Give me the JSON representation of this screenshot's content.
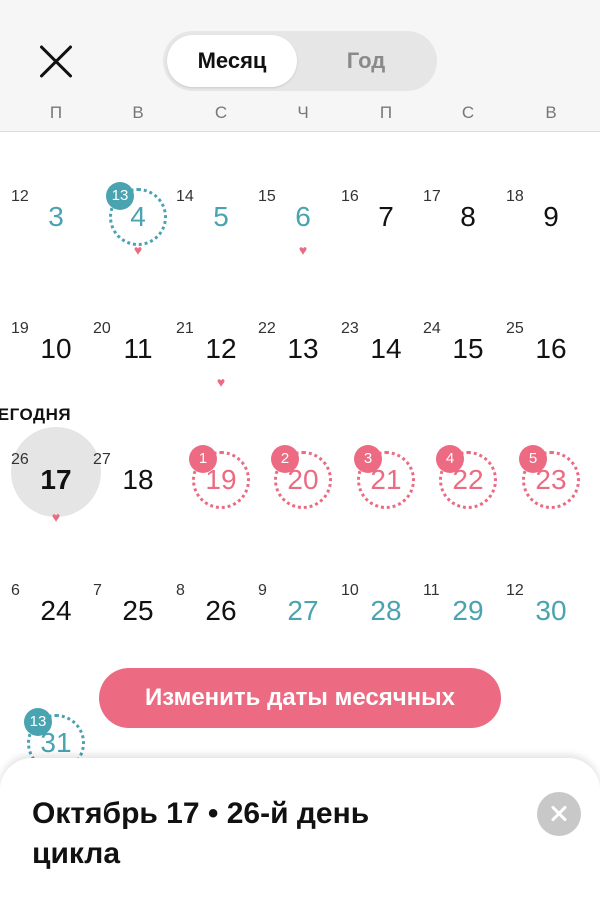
{
  "header": {
    "view_tabs": [
      {
        "label": "Месяц",
        "active": true
      },
      {
        "label": "Год",
        "active": false
      }
    ]
  },
  "weekdays": [
    "П",
    "В",
    "С",
    "Ч",
    "П",
    "С",
    "В"
  ],
  "today_label": "СЕГОДНЯ",
  "weeks": [
    [
      {
        "day": "3",
        "cycle_day": "12",
        "state": "teal"
      },
      {
        "day": "4",
        "cycle_day": "",
        "state": "ovulation",
        "badge": "13",
        "heart": true
      },
      {
        "day": "5",
        "cycle_day": "14",
        "state": "teal"
      },
      {
        "day": "6",
        "cycle_day": "15",
        "state": "teal",
        "heart": true
      },
      {
        "day": "7",
        "cycle_day": "16",
        "state": "normal"
      },
      {
        "day": "8",
        "cycle_day": "17",
        "state": "normal"
      },
      {
        "day": "9",
        "cycle_day": "18",
        "state": "normal"
      }
    ],
    [
      {
        "day": "10",
        "cycle_day": "19",
        "state": "normal"
      },
      {
        "day": "11",
        "cycle_day": "20",
        "state": "normal"
      },
      {
        "day": "12",
        "cycle_day": "21",
        "state": "normal",
        "heart": true
      },
      {
        "day": "13",
        "cycle_day": "22",
        "state": "normal"
      },
      {
        "day": "14",
        "cycle_day": "23",
        "state": "normal"
      },
      {
        "day": "15",
        "cycle_day": "24",
        "state": "normal"
      },
      {
        "day": "16",
        "cycle_day": "25",
        "state": "normal"
      }
    ],
    [
      {
        "day": "17",
        "cycle_day": "26",
        "state": "today",
        "heart": true
      },
      {
        "day": "18",
        "cycle_day": "27",
        "state": "normal"
      },
      {
        "day": "19",
        "cycle_day": "",
        "state": "period",
        "badge": "1"
      },
      {
        "day": "20",
        "cycle_day": "",
        "state": "period",
        "badge": "2"
      },
      {
        "day": "21",
        "cycle_day": "",
        "state": "period",
        "badge": "3"
      },
      {
        "day": "22",
        "cycle_day": "",
        "state": "period",
        "badge": "4"
      },
      {
        "day": "23",
        "cycle_day": "",
        "state": "period",
        "badge": "5"
      }
    ],
    [
      {
        "day": "24",
        "cycle_day": "6",
        "state": "normal"
      },
      {
        "day": "25",
        "cycle_day": "7",
        "state": "normal"
      },
      {
        "day": "26",
        "cycle_day": "8",
        "state": "normal"
      },
      {
        "day": "27",
        "cycle_day": "9",
        "state": "teal"
      },
      {
        "day": "28",
        "cycle_day": "10",
        "state": "teal"
      },
      {
        "day": "29",
        "cycle_day": "11",
        "state": "teal"
      },
      {
        "day": "30",
        "cycle_day": "12",
        "state": "teal"
      }
    ],
    [
      {
        "day": "31",
        "cycle_day": "",
        "state": "ovulation",
        "badge": "13"
      }
    ]
  ],
  "edit_period_button": "Изменить даты месячных",
  "detail_sheet": {
    "title": "Октябрь 17 • 26-й день цикла"
  },
  "colors": {
    "teal": "#4aa3b0",
    "pink": "#ec6b82",
    "today_bg": "#e5e5e5"
  },
  "icons": {
    "close": "close-icon",
    "heart": "heart-icon",
    "sheet_close": "close-circle-icon"
  }
}
